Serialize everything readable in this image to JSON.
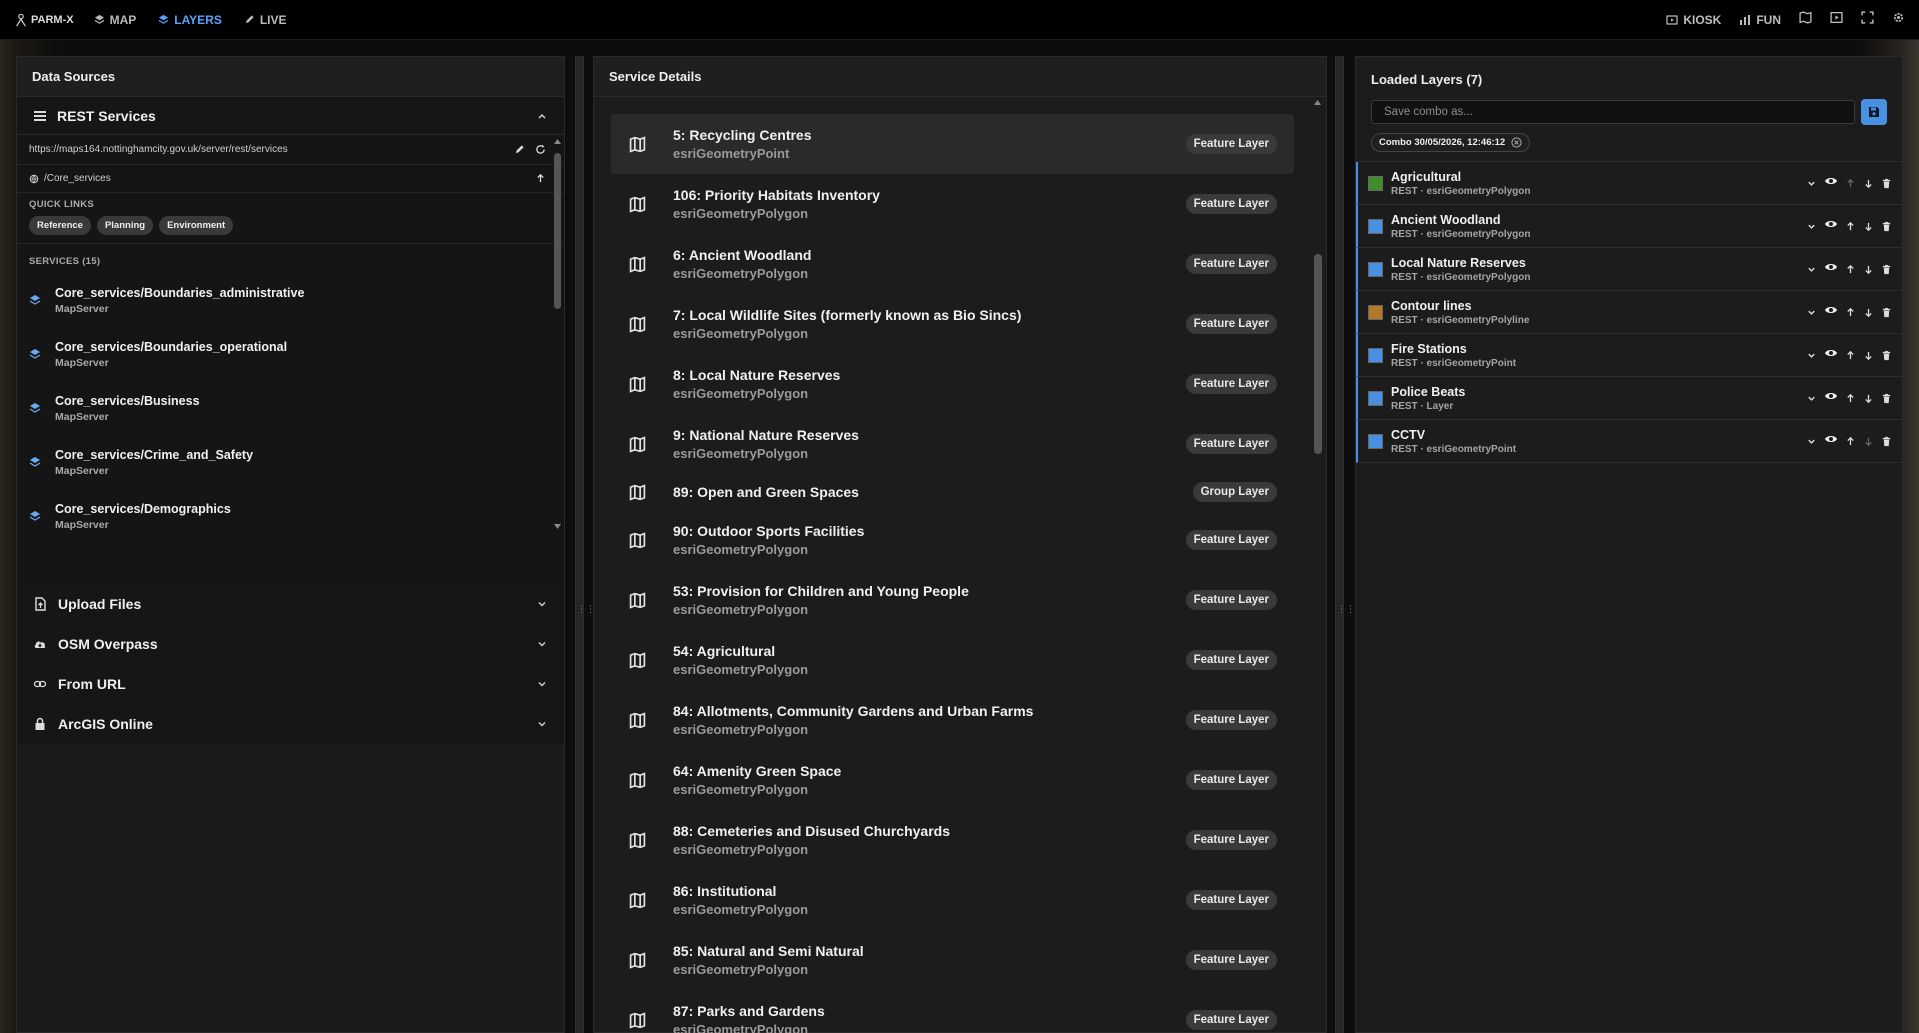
{
  "app": {
    "name": "PARM-X"
  },
  "nav": [
    {
      "label": "MAP",
      "active": false
    },
    {
      "label": "LAYERS",
      "active": true
    },
    {
      "label": "LIVE",
      "active": false
    }
  ],
  "topright": {
    "kiosk": "KIOSK",
    "fun": "FUN"
  },
  "left": {
    "title": "Data Sources",
    "rest_title": "REST Services",
    "url": "https://maps164.nottinghamcity.gov.uk/server/rest/services",
    "path": "/Core_services",
    "quick_links_title": "QUICK LINKS",
    "quick_links": [
      "Reference",
      "Planning",
      "Environment"
    ],
    "services_title": "SERVICES (15)",
    "services": [
      {
        "name": "Core_services/Boundaries_administrative",
        "type": "MapServer"
      },
      {
        "name": "Core_services/Boundaries_operational",
        "type": "MapServer"
      },
      {
        "name": "Core_services/Business",
        "type": "MapServer"
      },
      {
        "name": "Core_services/Crime_and_Safety",
        "type": "MapServer"
      },
      {
        "name": "Core_services/Demographics",
        "type": "MapServer"
      }
    ],
    "sections": [
      "Upload Files",
      "OSM Overpass",
      "From URL",
      "ArcGIS Online"
    ]
  },
  "middle": {
    "title": "Service Details",
    "layers": [
      {
        "name": "5: Recycling Centres",
        "geom": "esriGeometryPoint",
        "badge": "Feature Layer",
        "selected": true
      },
      {
        "name": "106: Priority Habitats Inventory",
        "geom": "esriGeometryPolygon",
        "badge": "Feature Layer"
      },
      {
        "name": "6: Ancient Woodland",
        "geom": "esriGeometryPolygon",
        "badge": "Feature Layer"
      },
      {
        "name": "7: Local Wildlife Sites (formerly known as Bio Sincs)",
        "geom": "esriGeometryPolygon",
        "badge": "Feature Layer"
      },
      {
        "name": "8: Local Nature Reserves",
        "geom": "esriGeometryPolygon",
        "badge": "Feature Layer"
      },
      {
        "name": "9: National Nature Reserves",
        "geom": "esriGeometryPolygon",
        "badge": "Feature Layer"
      },
      {
        "name": "89: Open and Green Spaces",
        "geom": "",
        "badge": "Group Layer",
        "short": true
      },
      {
        "name": "90: Outdoor Sports Facilities",
        "geom": "esriGeometryPolygon",
        "badge": "Feature Layer"
      },
      {
        "name": "53: Provision for Children and Young People",
        "geom": "esriGeometryPolygon",
        "badge": "Feature Layer"
      },
      {
        "name": "54: Agricultural",
        "geom": "esriGeometryPolygon",
        "badge": "Feature Layer"
      },
      {
        "name": "84: Allotments, Community Gardens and Urban Farms",
        "geom": "esriGeometryPolygon",
        "badge": "Feature Layer"
      },
      {
        "name": "64: Amenity Green Space",
        "geom": "esriGeometryPolygon",
        "badge": "Feature Layer"
      },
      {
        "name": "88: Cemeteries and Disused Churchyards",
        "geom": "esriGeometryPolygon",
        "badge": "Feature Layer"
      },
      {
        "name": "86: Institutional",
        "geom": "esriGeometryPolygon",
        "badge": "Feature Layer"
      },
      {
        "name": "85: Natural and Semi Natural",
        "geom": "esriGeometryPolygon",
        "badge": "Feature Layer"
      },
      {
        "name": "87: Parks and Gardens",
        "geom": "esriGeometryPolygon",
        "badge": "Feature Layer"
      }
    ]
  },
  "right": {
    "title": "Loaded Layers (7)",
    "save_placeholder": "Save combo as...",
    "combo": "Combo 30/05/2026, 12:46:12",
    "layers": [
      {
        "name": "Agricultural",
        "sub": "REST · esriGeometryPolygon",
        "color": "#3e8e2a"
      },
      {
        "name": "Ancient Woodland",
        "sub": "REST · esriGeometryPolygon",
        "color": "#4a90e2"
      },
      {
        "name": "Local Nature Reserves",
        "sub": "REST · esriGeometryPolygon",
        "color": "#4a90e2"
      },
      {
        "name": "Contour lines",
        "sub": "REST · esriGeometryPolyline",
        "color": "#b07a2a"
      },
      {
        "name": "Fire Stations",
        "sub": "REST · esriGeometryPoint",
        "color": "#4a90e2"
      },
      {
        "name": "Police Beats",
        "sub": "REST · Layer",
        "color": "#4a90e2"
      },
      {
        "name": "CCTV",
        "sub": "REST · esriGeometryPoint",
        "color": "#4a90e2"
      }
    ]
  }
}
